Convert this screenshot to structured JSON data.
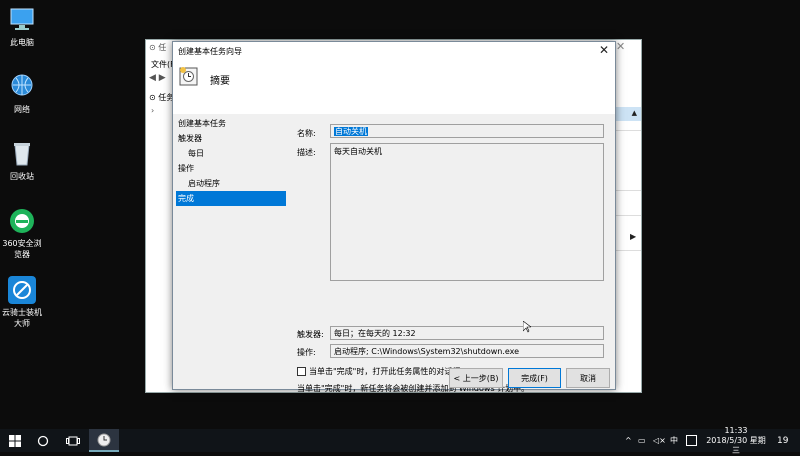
{
  "desktop": {
    "icons": [
      {
        "label": "此电脑"
      },
      {
        "label": "网络"
      },
      {
        "label": "回收站"
      },
      {
        "label": "360安全浏览器"
      },
      {
        "label": "云骑士装机大师"
      }
    ]
  },
  "background_window": {
    "menu_file": "文件(F",
    "tree_item": "任务",
    "title_fragment": "⊙ 任"
  },
  "dialog": {
    "title": "创建基本任务向导",
    "heading": "摘要",
    "nav": {
      "items": [
        {
          "label": "创建基本任务"
        },
        {
          "label": "触发器"
        },
        {
          "label": "每日"
        },
        {
          "label": "操作"
        },
        {
          "label": "启动程序"
        },
        {
          "label": "完成"
        }
      ]
    },
    "name_label": "名称:",
    "name_value": "自动关机",
    "desc_label": "描述:",
    "desc_value": "每天自动关机",
    "trigger_label": "触发器:",
    "trigger_value": "每日；在每天的 12:32",
    "action_label": "操作:",
    "action_value": "启动程序; C:\\Windows\\System32\\shutdown.exe",
    "checkbox_label": "当单击\"完成\"时，打开此任务属性的对话框。",
    "checkbox_checked": false,
    "info_text": "当单击\"完成\"时，新任务将会被创建并添加到 Windows 计划中。",
    "back_button": "< 上一步(B)",
    "finish_button": "完成(F)",
    "cancel_button": "取消"
  },
  "taskbar": {
    "ime": "中",
    "time": "11:33",
    "date": "2018/5/30 星期三",
    "notification_count": "19"
  },
  "colors": {
    "selection": "#0078d7",
    "taskbar": "#101418"
  }
}
